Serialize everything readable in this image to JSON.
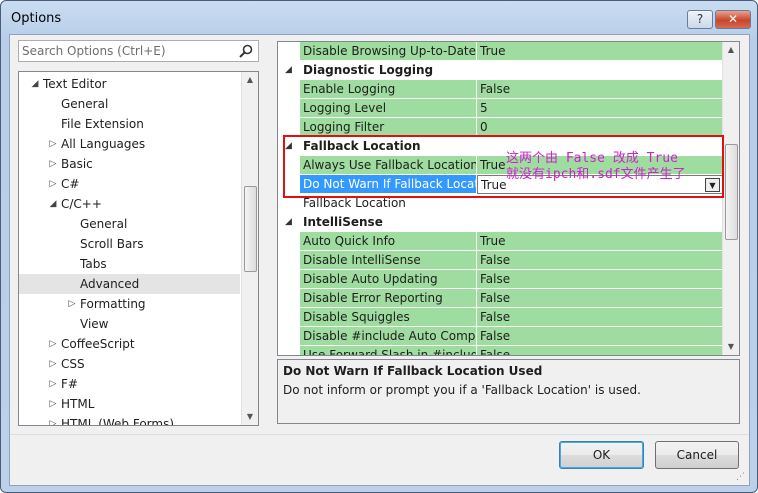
{
  "window": {
    "title": "Options",
    "help_label": "?",
    "close_label": "✕"
  },
  "search": {
    "placeholder": "Search Options (Ctrl+E)"
  },
  "tree": {
    "items": [
      {
        "label": "Text Editor",
        "arrow": "◢",
        "level": 0
      },
      {
        "label": "General",
        "arrow": "",
        "level": 1
      },
      {
        "label": "File Extension",
        "arrow": "",
        "level": 1
      },
      {
        "label": "All Languages",
        "arrow": "▷",
        "level": 1
      },
      {
        "label": "Basic",
        "arrow": "▷",
        "level": 1
      },
      {
        "label": "C#",
        "arrow": "▷",
        "level": 1
      },
      {
        "label": "C/C++",
        "arrow": "◢",
        "level": 1
      },
      {
        "label": "General",
        "arrow": "",
        "level": 2
      },
      {
        "label": "Scroll Bars",
        "arrow": "",
        "level": 2
      },
      {
        "label": "Tabs",
        "arrow": "",
        "level": 2
      },
      {
        "label": "Advanced",
        "arrow": "",
        "level": 2,
        "selected": true
      },
      {
        "label": "Formatting",
        "arrow": "▷",
        "level": 2
      },
      {
        "label": "View",
        "arrow": "",
        "level": 2
      },
      {
        "label": "CoffeeScript",
        "arrow": "▷",
        "level": 1
      },
      {
        "label": "CSS",
        "arrow": "▷",
        "level": 1
      },
      {
        "label": "F#",
        "arrow": "▷",
        "level": 1
      },
      {
        "label": "HTML",
        "arrow": "▷",
        "level": 1
      },
      {
        "label": "HTML (Web Forms)",
        "arrow": "▷",
        "level": 1
      }
    ]
  },
  "grid": {
    "rows": [
      {
        "type": "prop",
        "label": "Disable Browsing Up-to-Date",
        "value": "True"
      },
      {
        "type": "cat",
        "label": "Diagnostic Logging",
        "arrow": "◢"
      },
      {
        "type": "prop",
        "label": "Enable Logging",
        "value": "False"
      },
      {
        "type": "prop",
        "label": "Logging Level",
        "value": "5"
      },
      {
        "type": "prop",
        "label": "Logging Filter",
        "value": "0"
      },
      {
        "type": "cat",
        "label": "Fallback Location",
        "arrow": "◢"
      },
      {
        "type": "prop",
        "label": "Always Use Fallback Location",
        "value": "True"
      },
      {
        "type": "selected",
        "label": "Do Not Warn If Fallback Location Used",
        "value": "True"
      },
      {
        "type": "plain",
        "label": "Fallback Location",
        "value": ""
      },
      {
        "type": "cat",
        "label": "IntelliSense",
        "arrow": "◢"
      },
      {
        "type": "prop",
        "label": "Auto Quick Info",
        "value": "True"
      },
      {
        "type": "prop",
        "label": "Disable IntelliSense",
        "value": "False"
      },
      {
        "type": "prop",
        "label": "Disable Auto Updating",
        "value": "False"
      },
      {
        "type": "prop",
        "label": "Disable Error Reporting",
        "value": "False"
      },
      {
        "type": "prop",
        "label": "Disable Squiggles",
        "value": "False"
      },
      {
        "type": "prop",
        "label": "Disable #include Auto Completion",
        "value": "False"
      },
      {
        "type": "prop",
        "label": "Use Forward Slash in #include",
        "value": "False"
      }
    ]
  },
  "description": {
    "title": "Do Not Warn If Fallback Location Used",
    "body": "Do not inform or prompt you if a 'Fallback Location' is used."
  },
  "buttons": {
    "ok": "OK",
    "cancel": "Cancel"
  },
  "annotation": {
    "line1": "这两个由 False 改成 True",
    "line2": "就没有ipch和.sdf文件产生了",
    "color": "#d020d0",
    "box_color": "#e01010"
  },
  "colors": {
    "modified_row": "#9fdc9f",
    "selection": "#3399ff"
  }
}
